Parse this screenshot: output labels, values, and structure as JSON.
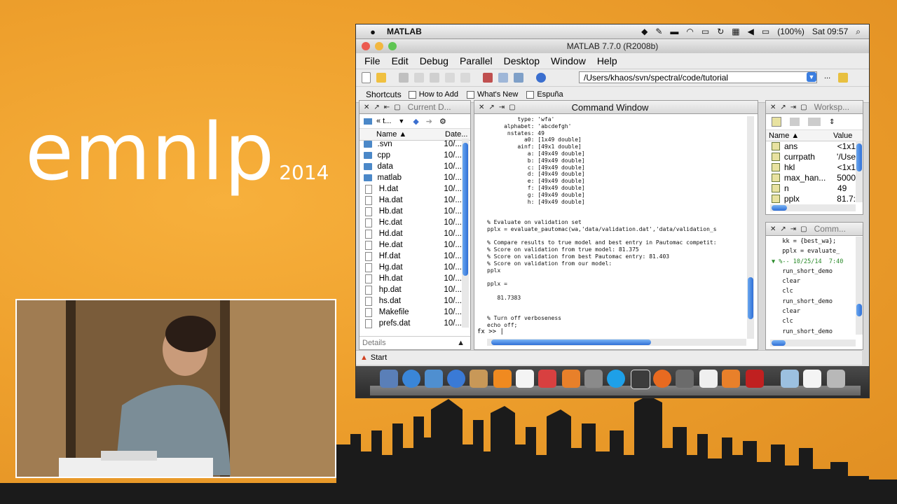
{
  "branding": {
    "logo_word": "emnlp",
    "logo_year": "2014"
  },
  "mac_menubar": {
    "app_name": "MATLAB",
    "battery": "(100%)",
    "clock": "Sat 09:57"
  },
  "window": {
    "title": "MATLAB  7.7.0 (R2008b)"
  },
  "menu": [
    "File",
    "Edit",
    "Debug",
    "Parallel",
    "Desktop",
    "Window",
    "Help"
  ],
  "toolbar": {
    "current_path": "/Users/khaos/svn/spectral/code/tutorial",
    "more": "..."
  },
  "shortcuts": {
    "label": "Shortcuts",
    "items": [
      "How to Add",
      "What's New",
      "Espuña"
    ]
  },
  "current_dir": {
    "title": "Current D...",
    "nav_label": "« t...",
    "col_name": "Name ▲",
    "col_date": "Date...",
    "details_label": "Details",
    "files": [
      {
        "name": ".svn",
        "date": "10/...",
        "type": "folder"
      },
      {
        "name": "cpp",
        "date": "10/...",
        "type": "folder"
      },
      {
        "name": "data",
        "date": "10/...",
        "type": "folder"
      },
      {
        "name": "matlab",
        "date": "10/...",
        "type": "folder"
      },
      {
        "name": "H.dat",
        "date": "10/...",
        "type": "file"
      },
      {
        "name": "Ha.dat",
        "date": "10/...",
        "type": "file"
      },
      {
        "name": "Hb.dat",
        "date": "10/...",
        "type": "file"
      },
      {
        "name": "Hc.dat",
        "date": "10/...",
        "type": "file"
      },
      {
        "name": "Hd.dat",
        "date": "10/...",
        "type": "file"
      },
      {
        "name": "He.dat",
        "date": "10/...",
        "type": "file"
      },
      {
        "name": "Hf.dat",
        "date": "10/...",
        "type": "file"
      },
      {
        "name": "Hg.dat",
        "date": "10/...",
        "type": "file"
      },
      {
        "name": "Hh.dat",
        "date": "10/...",
        "type": "file"
      },
      {
        "name": "hp.dat",
        "date": "10/...",
        "type": "file"
      },
      {
        "name": "hs.dat",
        "date": "10/...",
        "type": "file"
      },
      {
        "name": "Makefile",
        "date": "10/...",
        "type": "file"
      },
      {
        "name": "prefs.dat",
        "date": "10/...",
        "type": "file"
      }
    ]
  },
  "command_window": {
    "title": "Command Window",
    "lines": [
      "         type: 'wfa'",
      "     alphabet: 'abcdefgh'",
      "      nstates: 49",
      "           a0: [1x49 double]",
      "         ainf: [49x1 double]",
      "            a: [49x49 double]",
      "            b: [49x49 double]",
      "            c: [49x49 double]",
      "            d: [49x49 double]",
      "            e: [49x49 double]",
      "            f: [49x49 double]",
      "            g: [49x49 double]",
      "            h: [49x49 double]",
      "",
      "",
      "% Evaluate on validation set",
      "pplx = evaluate_pautomac(wa,'data/validation.dat','data/validation_s",
      "",
      "% Compare results to true model and best entry in Pautomac competit:",
      "% Score on validation from true model: 81.375",
      "% Score on validation from best Pautomac entry: 81.403",
      "% Score on validation from our model:",
      "pplx",
      "",
      "pplx =",
      "",
      "   81.7383",
      "",
      "",
      "% Turn off verboseness",
      "echo off;"
    ],
    "prompt": "fx >> |"
  },
  "workspace": {
    "title": "Worksp...",
    "col_name": "Name ▲",
    "col_value": "Value",
    "vars": [
      {
        "name": "ans",
        "value": "<1x1"
      },
      {
        "name": "currpath",
        "value": "'/Use"
      },
      {
        "name": "hkl",
        "value": "<1x1"
      },
      {
        "name": "max_han...",
        "value": "5000"
      },
      {
        "name": "n",
        "value": "49"
      },
      {
        "name": "pplx",
        "value": "81.7:"
      }
    ]
  },
  "history": {
    "title": "Comm...",
    "lines": [
      "   kk = {best_wa};",
      "   pplx = evaluate_",
      "▼ %-- 10/25/14  7:40",
      "   run_short_demo",
      "   clear",
      "   clc",
      "   run_short_demo",
      "   clear",
      "   clc",
      "   run_short_demo"
    ]
  },
  "statusbar": {
    "start_label": "Start"
  },
  "colors": {
    "orange_bg": "#f2a12e",
    "accent_blue": "#2f6fd6"
  }
}
